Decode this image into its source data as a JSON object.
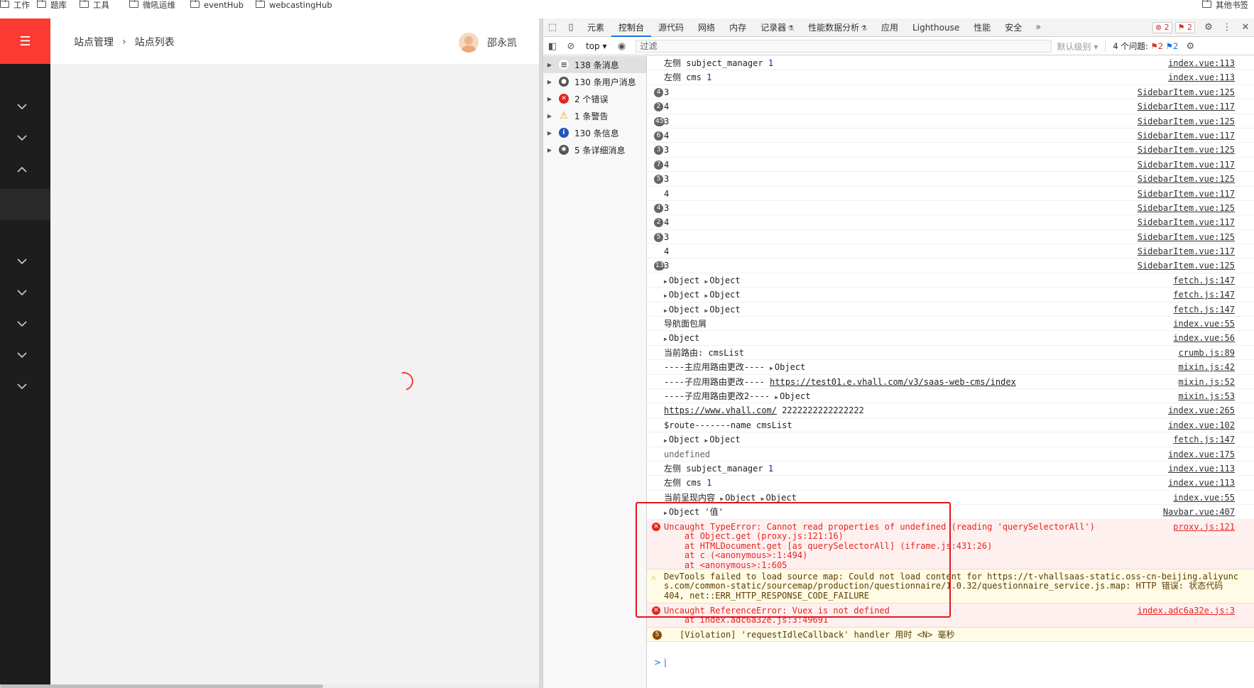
{
  "bookmarks": {
    "items": [
      "工作",
      "题库",
      "工具",
      "微吼运维",
      "eventHub",
      "webcastingHub"
    ],
    "other": "其他书签"
  },
  "app": {
    "breadcrumb": [
      "站点管理",
      "站点列表"
    ],
    "user": "邵永凯"
  },
  "devtools": {
    "tabs": [
      "元素",
      "控制台",
      "源代码",
      "网络",
      "内存",
      "记录器",
      "性能数据分析",
      "应用",
      "Lighthouse",
      "性能",
      "安全"
    ],
    "error_badge": "2",
    "issue_badge": "2",
    "context": "top ▾",
    "filter_placeholder": "过滤",
    "level": "默认级别 ▾",
    "issues_label": "4 个问题:",
    "issues_err": "2",
    "issues_info": "2",
    "sidebar": [
      {
        "label": "138 条消息",
        "kind": "list"
      },
      {
        "label": "130 条用户消息",
        "kind": "user"
      },
      {
        "label": "2 个错误",
        "kind": "error"
      },
      {
        "label": "1 条警告",
        "kind": "warning"
      },
      {
        "label": "130 条信息",
        "kind": "info"
      },
      {
        "label": "5 条详细消息",
        "kind": "verbose"
      }
    ],
    "logs": [
      {
        "text": "左侧 subject_manager",
        "num": "1",
        "src": "index.vue:113"
      },
      {
        "text": "左侧 cms",
        "num": "1",
        "src": "index.vue:113"
      },
      {
        "count": "4",
        "text": "3",
        "src": "SidebarItem.vue:125"
      },
      {
        "count": "2",
        "text": "4",
        "src": "SidebarItem.vue:117"
      },
      {
        "count": "45",
        "text": "3",
        "src": "SidebarItem.vue:125"
      },
      {
        "count": "6",
        "text": "4",
        "src": "SidebarItem.vue:117"
      },
      {
        "count": "3",
        "text": "3",
        "src": "SidebarItem.vue:125"
      },
      {
        "count": "7",
        "text": "4",
        "src": "SidebarItem.vue:117"
      },
      {
        "count": "5",
        "text": "3",
        "src": "SidebarItem.vue:125"
      },
      {
        "text": "4",
        "src": "SidebarItem.vue:117"
      },
      {
        "count": "4",
        "text": "3",
        "src": "SidebarItem.vue:125"
      },
      {
        "count": "2",
        "text": "4",
        "src": "SidebarItem.vue:117"
      },
      {
        "count": "5",
        "text": "3",
        "src": "SidebarItem.vue:125"
      },
      {
        "text": "4",
        "src": "SidebarItem.vue:117"
      },
      {
        "count": "13",
        "text": "3",
        "src": "SidebarItem.vue:125"
      },
      {
        "objs": [
          "Object",
          "Object"
        ],
        "src": "fetch.js:147"
      },
      {
        "objs": [
          "Object",
          "Object"
        ],
        "src": "fetch.js:147"
      },
      {
        "objs": [
          "Object",
          "Object"
        ],
        "src": "fetch.js:147"
      },
      {
        "text": "导航面包屑",
        "src": "index.vue:55"
      },
      {
        "objs": [
          "Object"
        ],
        "src": "index.vue:56"
      },
      {
        "text": "当前路由: cmsList",
        "src": "crumb.js:89"
      },
      {
        "text": "----主应用路由更改----",
        "objs": [
          "Object"
        ],
        "src": "mixin.js:42"
      },
      {
        "text": "----子应用路由更改----",
        "link": "https://test01.e.vhall.com/v3/saas-web-cms/index",
        "src": "mixin.js:52"
      },
      {
        "text": "----子应用路由更改2----",
        "objs": [
          "Object"
        ],
        "src": "mixin.js:53"
      },
      {
        "link": "https://www.vhall.com/",
        "text2": "2222222222222222",
        "src": "index.vue:265"
      },
      {
        "text": "$route-------name cmsList",
        "src": "index.vue:102"
      },
      {
        "objs": [
          "Object",
          "Object"
        ],
        "src": "fetch.js:147"
      },
      {
        "text": "undefined",
        "grey": true,
        "src": "index.vue:175"
      },
      {
        "text": "左侧 subject_manager",
        "num": "1",
        "src": "index.vue:113"
      },
      {
        "text": "左侧 cms",
        "num": "1",
        "src": "index.vue:113"
      },
      {
        "text": "当前呈现内容",
        "objs": [
          "Object",
          "Object"
        ],
        "src": "index.vue:55"
      },
      {
        "objs": [
          "Object"
        ],
        "text2": "'值'",
        "src": "Navbar.vue:407"
      }
    ],
    "error1": {
      "line1": "Uncaught TypeError: Cannot read properties of undefined (reading 'querySelectorAll')",
      "line2": "    at Object.get (proxy.js:121:16)",
      "line3": "    at HTMLDocument.get [as querySelectorAll] (iframe.js:431:26)",
      "line4": "    at c (<anonymous>:1:494)",
      "line5": "    at <anonymous>:1:605",
      "src": "proxy.js:121"
    },
    "warning1": {
      "line1": "DevTools failed to load source map: Could not load content for https://t-vhallsaas-static.oss-cn-beijing.aliyunc",
      "line2": "s.com/common-static/sourcemap/production/questionnaire/1.0.32/questionnaire_service.js.map: HTTP 错误: 状态代码",
      "line3": "404, net::ERR_HTTP_RESPONSE_CODE_FAILURE"
    },
    "error2": {
      "line1": "Uncaught ReferenceError: Vuex is not defined",
      "line2": "    at index.adc6a32e.js:3:49691",
      "src": "index.adc6a32e.js:3"
    },
    "violation": {
      "count": "5",
      "text": "[Violation] 'requestIdleCallback' handler 用时 <N> 毫秒"
    },
    "prompt": ">"
  }
}
